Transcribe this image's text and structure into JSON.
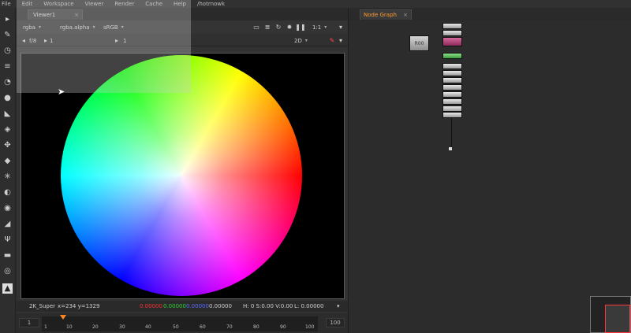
{
  "menu": [
    "File",
    "Edit",
    "Workspace",
    "Viewer",
    "Render",
    "Cache",
    "Help",
    "/hotrnowk"
  ],
  "viewer": {
    "tab_label": "Viewer1",
    "channels": "rgba",
    "alpha": "rgba.alpha",
    "colorspace": "sRGB",
    "zoom": "1:1",
    "mode": "2D",
    "fstop": "f/8",
    "frame_left": "1",
    "frame_right": "1"
  },
  "info": {
    "format": "2K_Super",
    "coords": "x=234 y=1329",
    "r": "0.00000",
    "g": "0.00000",
    "b": "0.00000",
    "a": "0.00000",
    "hsv": "H: 0 S:0.00 V:0.00",
    "l": "L: 0.00000"
  },
  "timeline": {
    "start": "1",
    "end": "100",
    "ticks": [
      "1",
      "10",
      "20",
      "30",
      "40",
      "50",
      "60",
      "70",
      "80",
      "90",
      "100"
    ]
  },
  "node_graph": {
    "tab_label": "Node Graph",
    "read_node_label": "R00"
  },
  "colors": {
    "accent": "#ff9a2e",
    "red_value": "#ff3030",
    "green_value": "#30d030",
    "blue_value": "#5a6bff",
    "node_pink": "#c0407a",
    "node_green": "#5ac85a"
  }
}
